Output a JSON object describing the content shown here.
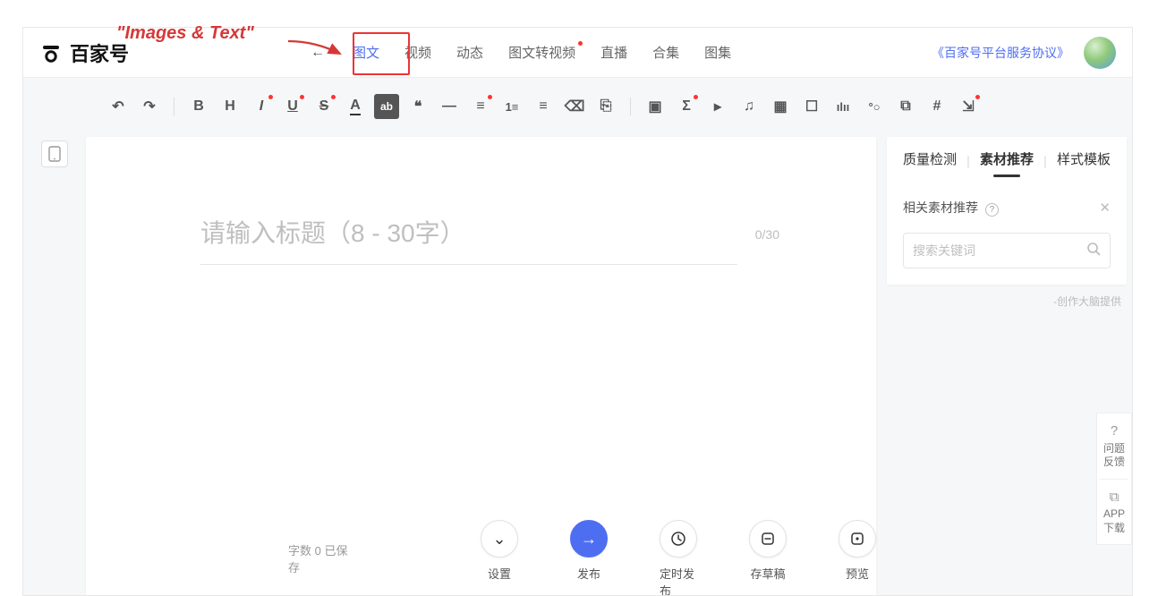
{
  "annotation": {
    "label": "\"Images & Text\""
  },
  "header": {
    "brand": "百家号",
    "back_glyph": "←",
    "tabs": [
      {
        "label": "图文",
        "active": true
      },
      {
        "label": "视频"
      },
      {
        "label": "动态"
      },
      {
        "label": "图文转视频",
        "dot": true
      },
      {
        "label": "直播"
      },
      {
        "label": "合集"
      },
      {
        "label": "图集"
      }
    ],
    "agreement": "《百家号平台服务协议》"
  },
  "toolbar": {
    "undo": "↶",
    "redo": "↷",
    "bold": "B",
    "heading": "H",
    "italic": "I",
    "underline": "U",
    "strike": "S",
    "fontcolor": "A",
    "highlight": "ab",
    "quote": "❝",
    "hr": "—",
    "align": "≡",
    "olist": "1≡",
    "ulist": "≡",
    "eraser": "⌫",
    "paste": "⎘",
    "image": "▣",
    "formula": "Σ",
    "video": "▸",
    "audio": "♫",
    "table": "▦",
    "card": "☐",
    "vote": "ılıı",
    "person": "°○",
    "link": "⧉",
    "hash": "#",
    "more": "⇲"
  },
  "editor": {
    "title_placeholder": "请输入标题（8 - 30字）",
    "title_count": "0/30"
  },
  "sidebar": {
    "tabs": {
      "quality": "质量检测",
      "material": "素材推荐",
      "template": "样式模板"
    },
    "subhead": "相关素材推荐",
    "search_placeholder": "搜索关键词",
    "provider": "-创作大脑提供"
  },
  "bottom": {
    "wordcount_label": "字数 0  已保存",
    "actions": {
      "settings": "设置",
      "publish": "发布",
      "schedule": "定时发布",
      "draft": "存草稿",
      "preview": "预览"
    }
  },
  "float": {
    "q_icon": "?",
    "feedback": "问题\n反馈",
    "scan_icon": "⧉",
    "app": "APP\n下载"
  }
}
